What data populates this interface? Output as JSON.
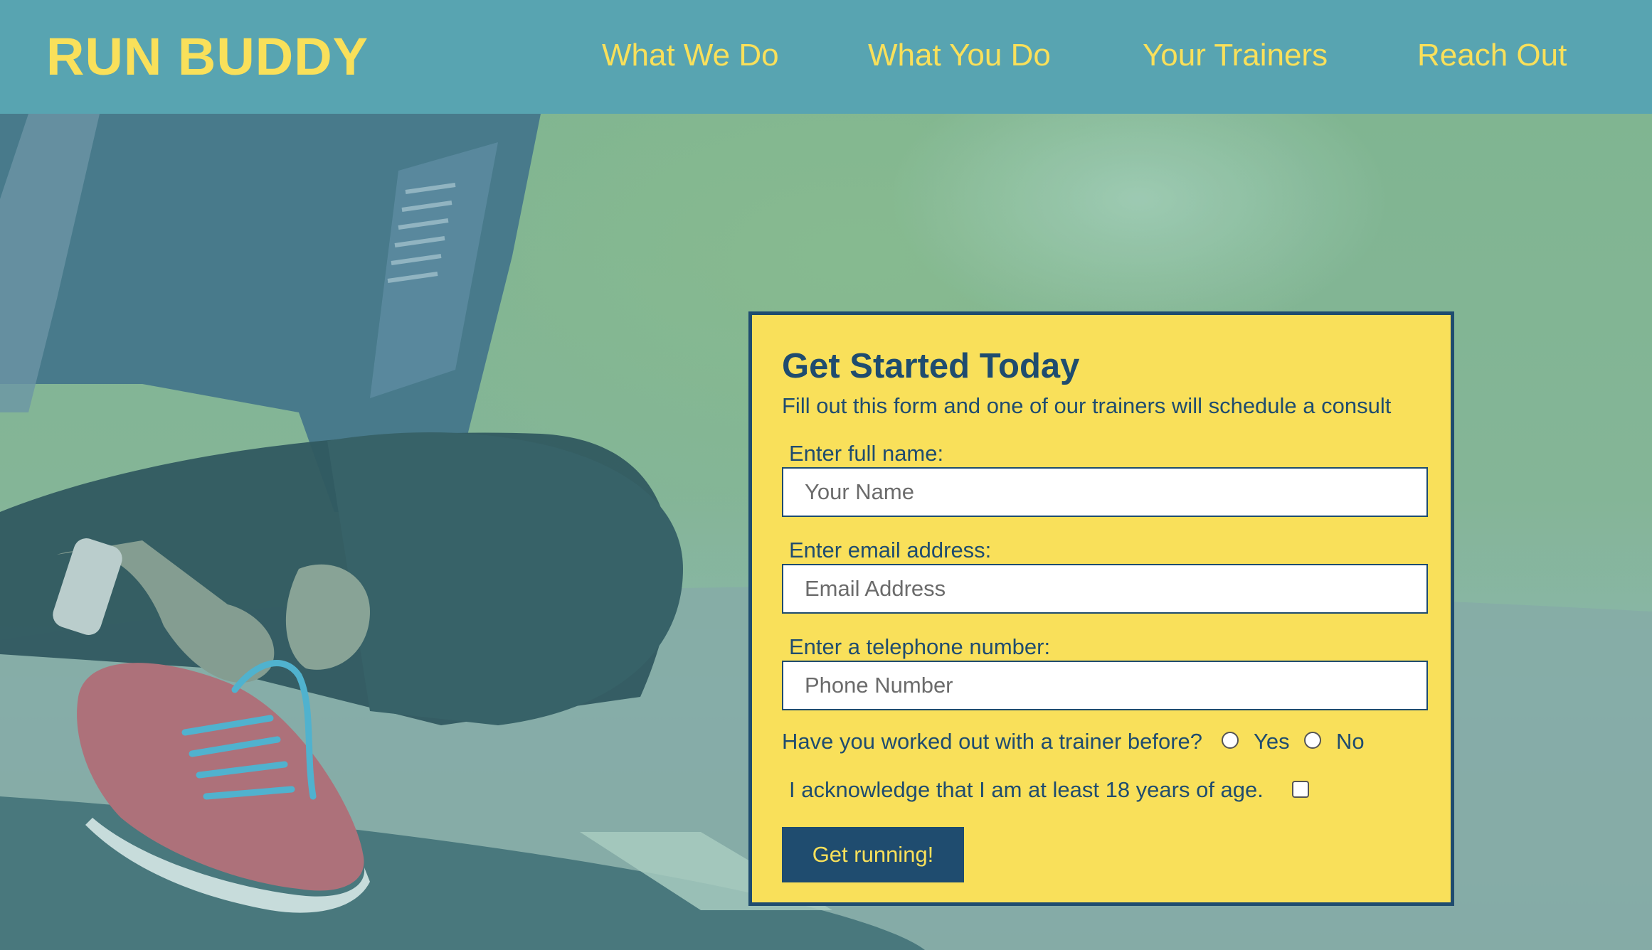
{
  "header": {
    "brand": "RUN BUDDY",
    "nav": [
      "What We Do",
      "What You Do",
      "Your Trainers",
      "Reach Out"
    ]
  },
  "form": {
    "title": "Get Started Today",
    "subtitle": "Fill out this form and one of our trainers will schedule a consult",
    "fields": [
      {
        "label": "Enter full name:",
        "placeholder": "Your Name",
        "value": ""
      },
      {
        "label": "Enter email address:",
        "placeholder": "Email Address",
        "value": ""
      },
      {
        "label": "Enter a telephone number:",
        "placeholder": "Phone Number",
        "value": ""
      }
    ],
    "question": "Have you worked out with a trainer before?",
    "options": [
      "Yes",
      "No"
    ],
    "acknowledge": "I acknowledge that I am at least 18 years of age.",
    "submit_label": "Get running!"
  },
  "colors": {
    "header_bg": "#58a4b1",
    "accent_yellow": "#f9e05a",
    "navy": "#1f4c6f"
  },
  "icons": [
    "radio-button-icon",
    "checkbox-icon"
  ]
}
